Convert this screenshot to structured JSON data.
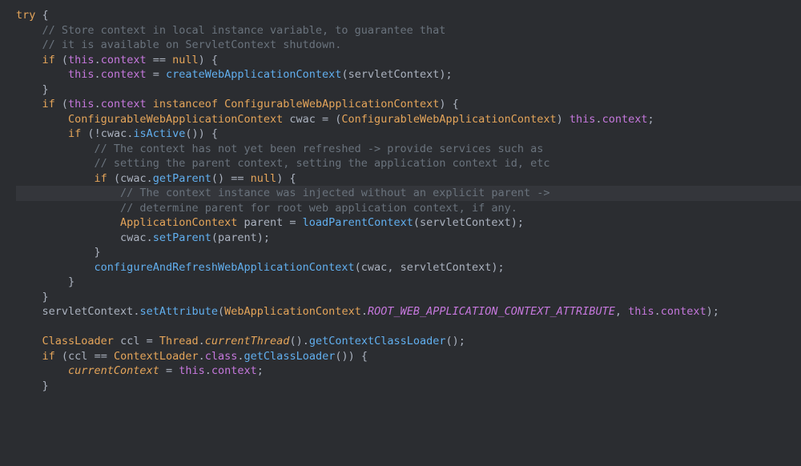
{
  "code": {
    "kw_try": "try",
    "brace_open": " {",
    "cmt1": "// Store context in local instance variable, to guarantee that",
    "cmt2": "// it is available on ServletContext shutdown.",
    "kw_if": "if",
    "paren_open": " (",
    "kw_this": "this",
    "dot": ".",
    "context": "context",
    "eqeq": " == ",
    "kw_null": "null",
    "paren_close_brace": ") {",
    "assign": " = ",
    "fn_createWAC": "createWebApplicationContext",
    "arg_servletContext": "servletContext",
    "paren_close_semi": ");",
    "brace_close": "}",
    "kw_instanceof": " instanceof ",
    "type_CWAC": "ConfigurableWebApplicationContext",
    "space": " ",
    "var_cwac": "cwac",
    "assign2": " = (",
    "cast_close": ") ",
    "semi": ";",
    "bang": "!",
    "fn_isActive": "isActive",
    "empty_parens_brace": "()) {",
    "cmt3": "// The context has not yet been refreshed -> provide services such as",
    "cmt4": "// setting the parent context, setting the application context id, etc",
    "fn_getParent": "getParent",
    "empty_parens": "()",
    "cmt5": "// The context instance was injected without an explicit parent ->",
    "cmt6": "// determine parent for root web application context, if any.",
    "type_AppCtx": "ApplicationContext",
    "var_parent": "parent",
    "fn_loadParent": "loadParentContext",
    "fn_setParent": "setParent",
    "open_paren": "(",
    "close_paren_semi": ");",
    "fn_configRefresh": "configureAndRefreshWebApplicationContext",
    "comma": ", ",
    "var_servletContext": "servletContext",
    "fn_setAttribute": "setAttribute",
    "type_WAC": "WebApplicationContext",
    "const_root": "ROOT_WEB_APPLICATION_CONTEXT_ATTRIBUTE",
    "type_ClassLoader": "ClassLoader",
    "var_ccl": "ccl",
    "type_Thread": "Thread",
    "fn_currentThread": "currentThread",
    "fn_getCtxCL": "getContextClassLoader",
    "empty_parens_semi": "();",
    "type_ContextLoader": "ContextLoader",
    "kw_class": "class",
    "fn_getCL": "getClassLoader",
    "var_currentContext": "currentContext",
    "indent1": "    ",
    "indent2": "        ",
    "indent3": "            ",
    "indent4": "                ",
    "indent5": "                    "
  }
}
